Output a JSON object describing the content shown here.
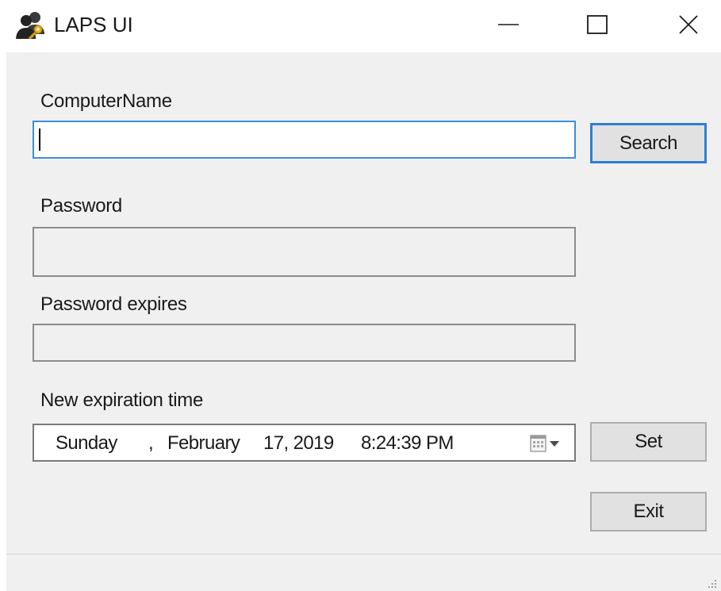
{
  "window": {
    "title": "LAPS UI",
    "icon": "users-key-icon",
    "controls": [
      "minimize-icon",
      "maximize-icon",
      "close-icon"
    ]
  },
  "form": {
    "computer_name": {
      "label": "ComputerName",
      "value": "",
      "placeholder": ""
    },
    "search_button": "Search",
    "password": {
      "label": "Password",
      "value": ""
    },
    "password_expires": {
      "label": "Password expires",
      "value": ""
    },
    "new_expiration": {
      "label": "New expiration time",
      "weekday": "Sunday",
      "comma": ",",
      "month": "February",
      "day_year": "17, 2019",
      "time": "8:24:39 PM",
      "dropdown_icon": "calendar-dropdown-icon"
    },
    "set_button": "Set",
    "exit_button": "Exit"
  },
  "colors": {
    "client_bg": "#f0f0f0",
    "focus_border": "#3c8fd8",
    "default_button_border": "#2e7fd3",
    "button_bg": "#e1e1e1"
  }
}
